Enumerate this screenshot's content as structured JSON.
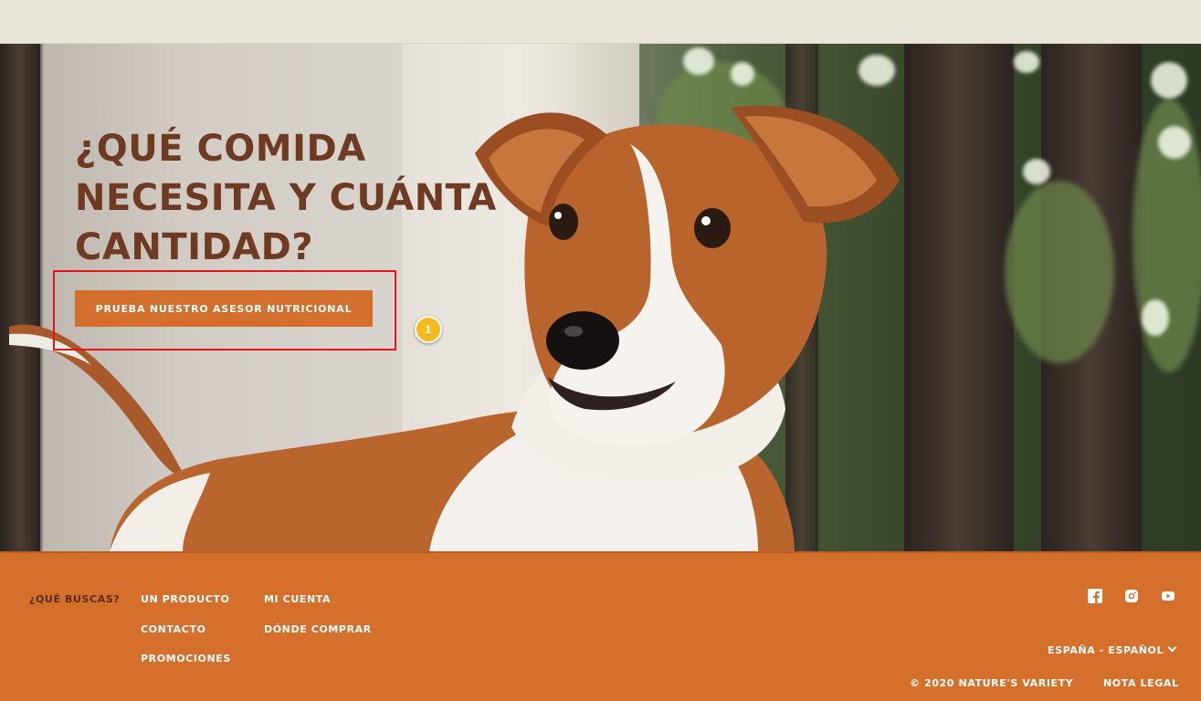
{
  "hero": {
    "headline_lines": [
      "¿QUÉ COMIDA",
      "NECESITA Y CUÁNTA",
      "CANTIDAD?"
    ],
    "cta_label": "PRUEBA NUESTRO ASESOR NUTRICIONAL",
    "annotation_marker": "1"
  },
  "footer": {
    "question_label": "¿QUÉ BUSCAS?",
    "links": {
      "product": "UN PRODUCTO",
      "account": "MI CUENTA",
      "contact": "CONTACTO",
      "where_to_buy": "DÓNDE COMPRAR",
      "promotions": "PROMOCIONES"
    },
    "social_icons": [
      "facebook-icon",
      "instagram-icon",
      "youtube-icon"
    ],
    "language": "ESPAÑA - ESPAÑOL",
    "copyright": "© 2020 NATURE'S VARIETY",
    "legal": "NOTA LEGAL"
  },
  "colors": {
    "accent": "#d4702c",
    "headline": "#6e3a22",
    "highlight": "#e0161b",
    "marker": "#f4bb1e"
  }
}
